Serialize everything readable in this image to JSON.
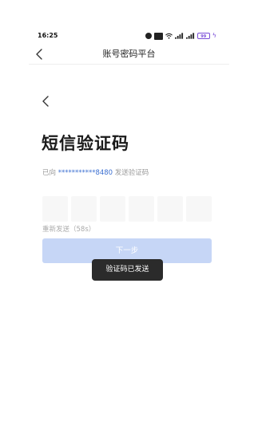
{
  "status_bar": {
    "time": "16:25",
    "battery_level": "99",
    "icons": [
      "alarm-icon",
      "hd-icon",
      "wifi-icon",
      "signal-icon",
      "signal-icon",
      "battery-icon",
      "charging-icon"
    ]
  },
  "header": {
    "title": "账号密码平台",
    "back_icon": "chevron-left-icon"
  },
  "main": {
    "back_icon": "chevron-left-icon",
    "heading": "短信验证码",
    "sent_prefix": "已向 ",
    "phone_masked": "***********8480",
    "sent_suffix": " 发送验证码",
    "code_length": 6,
    "resend_label": "重新发送（58s）",
    "next_label": "下一步"
  },
  "toast": {
    "message": "验证码已发送"
  },
  "colors": {
    "accent": "#3b6fd1",
    "button_disabled": "#c6d6f6",
    "toast_bg": "#2b2b2b",
    "battery": "#7a4dd8"
  }
}
